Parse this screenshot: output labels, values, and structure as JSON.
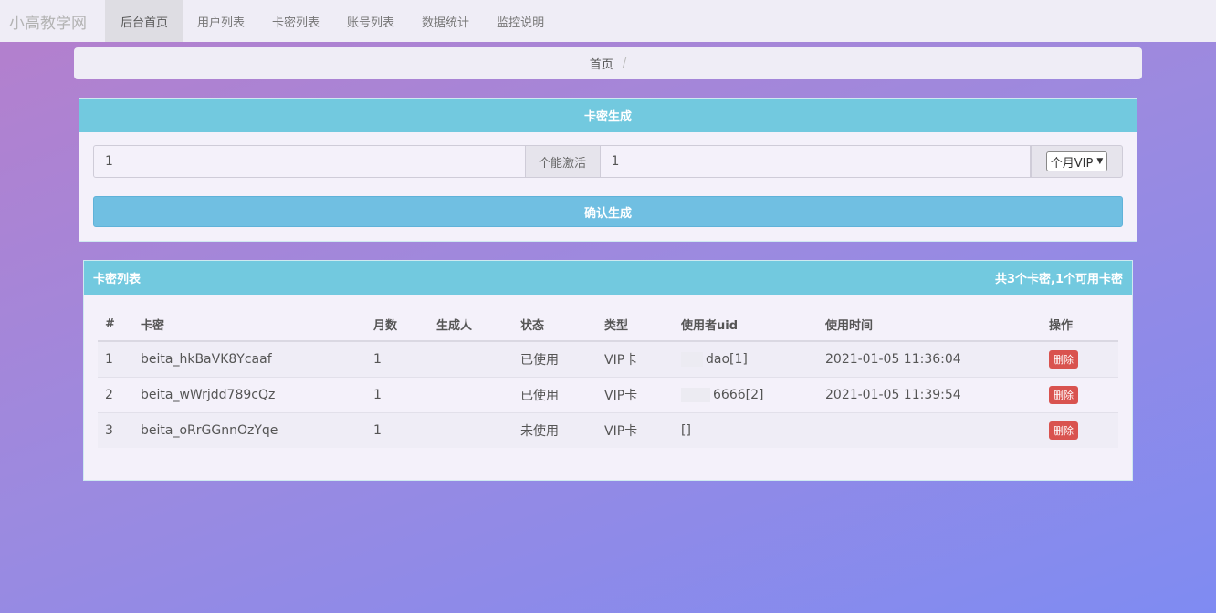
{
  "navbar": {
    "brand": "小高教学网",
    "items": [
      {
        "label": "后台首页",
        "active": true
      },
      {
        "label": "用户列表",
        "active": false
      },
      {
        "label": "卡密列表",
        "active": false
      },
      {
        "label": "账号列表",
        "active": false
      },
      {
        "label": "数据统计",
        "active": false
      },
      {
        "label": "监控说明",
        "active": false
      }
    ]
  },
  "breadcrumb": {
    "home": "首页",
    "separator": "/"
  },
  "generator": {
    "title": "卡密生成",
    "count_value": "1",
    "count_addon": "个能激活",
    "month_value": "1",
    "type_selected": "个月VIP",
    "submit_label": "确认生成"
  },
  "card_list": {
    "title": "卡密列表",
    "summary": "共3个卡密,1个可用卡密",
    "columns": [
      "#",
      "卡密",
      "月数",
      "生成人",
      "状态",
      "类型",
      "使用者uid",
      "使用时间",
      "操作"
    ],
    "rows": [
      {
        "index": "1",
        "card": "beita_hkBaVK8Ycaaf",
        "months": "1",
        "creator": "",
        "status": "已使用",
        "type": "VIP卡",
        "uid": "dao[1]",
        "time": "2021-01-05 11:36:04",
        "action": "删除"
      },
      {
        "index": "2",
        "card": "beita_wWrjdd789cQz",
        "months": "1",
        "creator": "",
        "status": "已使用",
        "type": "VIP卡",
        "uid": "6666[2]",
        "time": "2021-01-05 11:39:54",
        "action": "删除"
      },
      {
        "index": "3",
        "card": "beita_oRrGGnnOzYqe",
        "months": "1",
        "creator": "",
        "status": "未使用",
        "type": "VIP卡",
        "uid": "[]",
        "time": "",
        "action": "删除"
      }
    ]
  },
  "colors": {
    "panel_header": "#72c9df",
    "button": "#70bfe2",
    "danger": "#d9534f"
  }
}
